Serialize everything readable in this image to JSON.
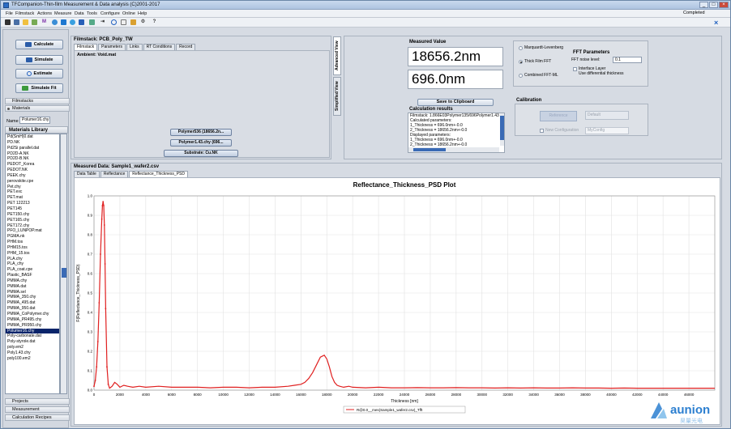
{
  "window": {
    "title": "TFCompanion-Thin-film Measurement & Data analysis (C)2001-2017",
    "minimize": "_",
    "maximize": "□",
    "close": "×"
  },
  "menu": [
    "File",
    "Filmstack",
    "Actions",
    "Measure",
    "Data",
    "Tools",
    "Configure",
    "Online",
    "Help"
  ],
  "status": {
    "text": "Completed",
    "progress_fraction": 1.0
  },
  "toolbar": {
    "close_label": "×",
    "icons": [
      "save-icon",
      "open-icon",
      "new-icon",
      "export-icon",
      "measure-icon",
      "blue-icon-1",
      "blue-icon-2",
      "blue-icon-3",
      "blue-icon-4",
      "chart-icon",
      "play-icon",
      "circle-icon",
      "document-icon",
      "export-icon-2",
      "tools-icon",
      "help-icon"
    ]
  },
  "left": {
    "calculate": "Calculate",
    "simulate": "Simulate",
    "estimate": "Estimate",
    "simulate_fit": "Simulate Fit",
    "filmstacks": "Filmstacks",
    "materials": "Materials",
    "name_label": "Name",
    "name_value": "Polumer16.chy",
    "library_title": "Materials Library",
    "library": [
      "Pd(SmH)0.dat",
      "PD.NK",
      "Pd2Si parallel.dat",
      "PD2D-A.NK",
      "PD2D-B.NK",
      "PEDOT_Korea",
      "PEDOT.NK",
      "PEEK.chy",
      "perovskite.cpe",
      "Pet.chy",
      "PET.exc",
      "PET.mat",
      "PET 122213",
      "PET145",
      "PET150.chy",
      "PET165.chy",
      "PET172.chy",
      "PFO_LUNPOP.mat",
      "PGMA.nk",
      "PHM.tos",
      "PHM15.tos",
      "PHM_15.tos",
      "PLA.chy",
      "PLA_chy",
      "PLA_coat.cpe",
      "Plastic_BASF",
      "PMMA.chy",
      "PMMA.dat",
      "PMMA.sel",
      "PMMA_350.chy",
      "PMMA_495.dat",
      "PMMA_950.dat",
      "PMMA_CoPolymer.chy",
      "PMMA_PR495.chy",
      "PMMA_PR950.chy",
      "Polumer16.chy",
      "Poly-carbonate.dat",
      "Poly-styrole.dat",
      "poly.em2",
      "Poly1.43.chy",
      "poly100.em2"
    ],
    "selected_index": 35,
    "projects": "Projects",
    "measurement": "Measurement",
    "recipes": "Calculation Recipes"
  },
  "film": {
    "header": "Filmstack: PCB_Poly_TW",
    "tabs": [
      "Filmstack",
      "Parameters",
      "Links",
      "RT Conditions",
      "Record"
    ],
    "ambient": "Ambient: Void.mat",
    "layers": [
      "Polymer536 (18656.2n...",
      "Polymer1.43.chy (696...",
      "Substrate: Cu.NK"
    ],
    "vtabs": [
      "Advanced View",
      "Simplified View"
    ]
  },
  "results": {
    "measured_label": "Measured Value",
    "value1": "18656.2nm",
    "value2": "696.0nm",
    "save": "Save to Clipboard",
    "calc_title": "Calculation results",
    "calc_lines": [
      "Filmstack: 1.866E03Polymer135/696Polymer1.43",
      "Calculated parameters:",
      "1_Thickness = 696.0nm+-0.0",
      "2_Thickness = 18656.2nm+-0.0",
      "Displayed parameters:",
      "1_Thickness = 696.0nm+-0.0",
      "2_Thickness = 18656.2nm+-0.0"
    ],
    "methods": [
      "Marquardt-Levenberg",
      "Thick Film FFT",
      "Combined FFT-ML"
    ],
    "method_selected": 1,
    "fft_title": "FFT Parameters",
    "fft_noise_label": "FFT noise level:",
    "fft_noise_value": "0.1",
    "interface_layer": "Interface Layer",
    "use_diff": "Use differential thickness",
    "calib_title": "Calibration",
    "calib_btn": "Reference",
    "calib_select": "Default",
    "new_config": "New Configuration",
    "config_name": "MyConfig"
  },
  "chart_panel": {
    "header": "Measured Data: Sample1_wafer2.csv",
    "tabs": [
      "Data Table",
      "Reflectance",
      "Reflectance_Thickness_PSD"
    ]
  },
  "chart_data": {
    "type": "line",
    "title": "Reflectance_Thickness_PSD Plot",
    "xlabel": "Thickness [nm]",
    "ylabel": "F(Reflectance_Thickness_PSD)",
    "xlim": [
      0,
      48000
    ],
    "ylim": [
      0,
      1.0
    ],
    "xticks": [
      0,
      2000,
      4000,
      6000,
      8000,
      10000,
      12000,
      14000,
      16000,
      18000,
      20000,
      22000,
      24000,
      26000,
      28000,
      30000,
      32000,
      34000,
      36000,
      38000,
      40000,
      42000,
      44000,
      46000
    ],
    "yticks": [
      0,
      0.1,
      0.2,
      0.3,
      0.4,
      0.5,
      0.6,
      0.7,
      0.8,
      0.9,
      1.0
    ],
    "grid": true,
    "legend": "R@0.0__mes(Sample1_wafer2.csv)_Tfft",
    "legend_position": "bottom-center",
    "color": "#e02020",
    "series": [
      {
        "name": "R@0.0__mes(Sample1_wafer2.csv)_Tfft",
        "x": [
          0,
          100,
          200,
          300,
          400,
          500,
          600,
          650,
          700,
          750,
          800,
          850,
          900,
          1000,
          1100,
          1200,
          1400,
          1600,
          1800,
          2000,
          2300,
          2600,
          3000,
          3500,
          4000,
          5000,
          6000,
          7000,
          8000,
          9000,
          10000,
          11000,
          12000,
          13000,
          14000,
          15000,
          15500,
          16000,
          16300,
          16600,
          16900,
          17200,
          17500,
          17800,
          18000,
          18200,
          18400,
          18600,
          18800,
          19000,
          19300,
          19700,
          20000,
          21000,
          22000,
          23000,
          24000,
          25000,
          26000,
          27000,
          28000,
          29000,
          30000,
          31000,
          32000,
          33000,
          34000,
          35000,
          36000,
          37000,
          38000,
          39000,
          40000,
          41000,
          42000,
          43000,
          44000,
          45000,
          46000,
          47000,
          48000
        ],
        "y": [
          0.02,
          0.05,
          0.12,
          0.25,
          0.45,
          0.7,
          0.88,
          0.95,
          0.97,
          0.95,
          0.85,
          0.65,
          0.42,
          0.12,
          0.03,
          0.01,
          0.02,
          0.04,
          0.03,
          0.015,
          0.025,
          0.02,
          0.015,
          0.02,
          0.015,
          0.02,
          0.015,
          0.015,
          0.015,
          0.012,
          0.015,
          0.015,
          0.012,
          0.015,
          0.015,
          0.02,
          0.025,
          0.03,
          0.04,
          0.06,
          0.09,
          0.13,
          0.17,
          0.18,
          0.16,
          0.12,
          0.07,
          0.04,
          0.025,
          0.02,
          0.015,
          0.02,
          0.015,
          0.012,
          0.015,
          0.012,
          0.012,
          0.013,
          0.012,
          0.012,
          0.013,
          0.012,
          0.012,
          0.011,
          0.012,
          0.011,
          0.012,
          0.011,
          0.011,
          0.012,
          0.011,
          0.011,
          0.01,
          0.011,
          0.01,
          0.01,
          0.01,
          0.01,
          0.01,
          0.01,
          0.01
        ]
      }
    ]
  }
}
